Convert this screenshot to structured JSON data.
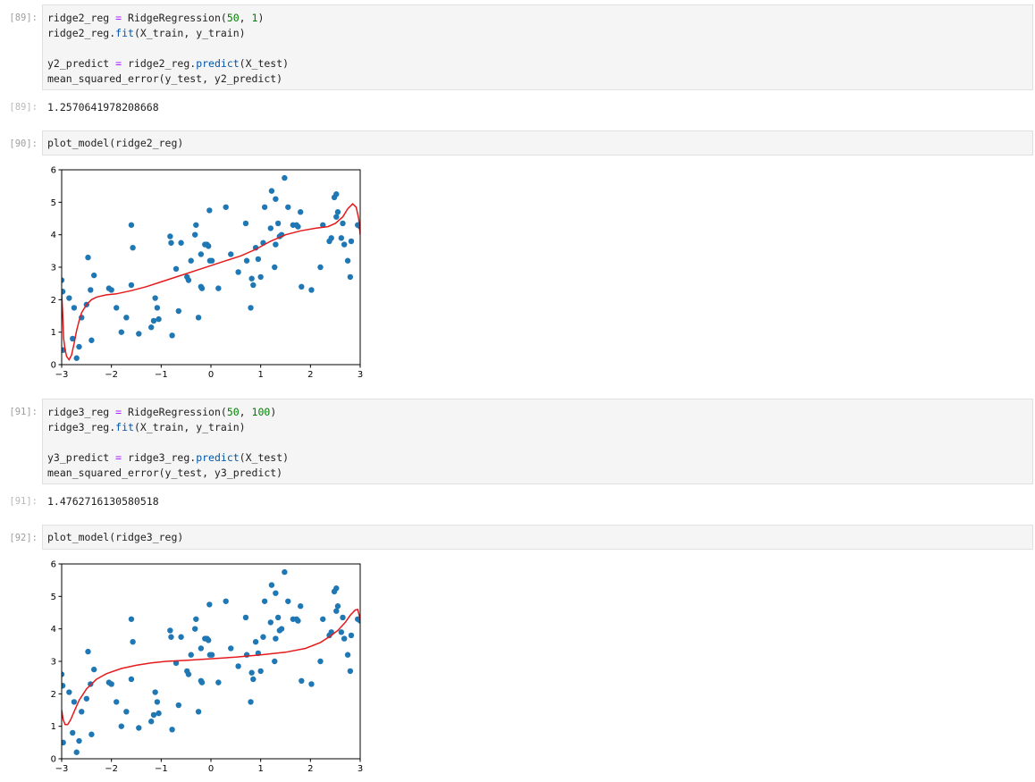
{
  "cells": [
    {
      "prompt": "[89]:",
      "lines": [
        [
          "ridge2_reg ",
          "=",
          " RidgeRegression(",
          "50",
          ", ",
          "1",
          ")"
        ],
        [
          "ridge2_reg.",
          "fit",
          "(X_train, y_train)"
        ],
        [
          ""
        ],
        [
          "y2_predict ",
          "=",
          " ridge2_reg.",
          "predict",
          "(X_test)"
        ],
        [
          "mean_squared_error(y_test, y2_predict)"
        ]
      ]
    },
    {
      "prompt": "[89]:",
      "output": "1.2570641978208668"
    },
    {
      "prompt": "[90]:",
      "code": "plot_model(ridge2_reg)"
    },
    {
      "prompt": "[91]:",
      "lines": [
        [
          "ridge3_reg ",
          "=",
          " RidgeRegression(",
          "50",
          ", ",
          "100",
          ")"
        ],
        [
          "ridge3_reg.",
          "fit",
          "(X_train, y_train)"
        ],
        [
          ""
        ],
        [
          "y3_predict ",
          "=",
          " ridge3_reg.",
          "predict",
          "(X_test)"
        ],
        [
          "mean_squared_error(y_test, y3_predict)"
        ]
      ]
    },
    {
      "prompt": "[91]:",
      "output": "1.4762716130580518"
    },
    {
      "prompt": "[92]:",
      "code": "plot_model(ridge3_reg)"
    }
  ],
  "colors": {
    "points": "#1f77b4",
    "curve": "#e41a1c"
  },
  "chart_data": [
    {
      "type": "scatter",
      "xlim": [
        -3,
        3
      ],
      "ylim": [
        0,
        6
      ],
      "xticks": [
        "−3",
        "−2",
        "−1",
        "0",
        "1",
        "2",
        "3"
      ],
      "yticks": [
        "0",
        "1",
        "2",
        "3",
        "4",
        "5",
        "6"
      ],
      "points": [
        [
          -3.0,
          2.6
        ],
        [
          -2.98,
          2.25
        ],
        [
          -2.97,
          0.45
        ],
        [
          -2.85,
          2.05
        ],
        [
          -2.78,
          0.8
        ],
        [
          -2.75,
          1.75
        ],
        [
          -2.7,
          0.2
        ],
        [
          -2.65,
          0.55
        ],
        [
          -2.6,
          1.45
        ],
        [
          -2.5,
          1.85
        ],
        [
          -2.47,
          3.3
        ],
        [
          -2.42,
          2.3
        ],
        [
          -2.4,
          0.75
        ],
        [
          -2.35,
          2.75
        ],
        [
          -2.05,
          2.35
        ],
        [
          -2.0,
          2.3
        ],
        [
          -1.9,
          1.75
        ],
        [
          -1.8,
          1.0
        ],
        [
          -1.7,
          1.45
        ],
        [
          -1.6,
          4.3
        ],
        [
          -1.57,
          3.6
        ],
        [
          -1.6,
          2.45
        ],
        [
          -1.45,
          0.95
        ],
        [
          -1.2,
          1.15
        ],
        [
          -1.15,
          1.35
        ],
        [
          -1.12,
          2.05
        ],
        [
          -1.08,
          1.75
        ],
        [
          -1.05,
          1.4
        ],
        [
          -0.82,
          3.95
        ],
        [
          -0.8,
          3.75
        ],
        [
          -0.78,
          0.9
        ],
        [
          -0.7,
          2.95
        ],
        [
          -0.65,
          1.65
        ],
        [
          -0.6,
          3.75
        ],
        [
          -0.48,
          2.7
        ],
        [
          -0.45,
          2.6
        ],
        [
          -0.4,
          3.2
        ],
        [
          -0.32,
          4.0
        ],
        [
          -0.3,
          4.3
        ],
        [
          -0.25,
          1.45
        ],
        [
          -0.2,
          2.4
        ],
        [
          -0.2,
          3.4
        ],
        [
          -0.18,
          2.35
        ],
        [
          -0.12,
          3.7
        ],
        [
          -0.08,
          3.7
        ],
        [
          -0.05,
          3.65
        ],
        [
          -0.03,
          4.75
        ],
        [
          -0.02,
          3.2
        ],
        [
          0.02,
          3.2
        ],
        [
          0.15,
          2.35
        ],
        [
          0.3,
          4.85
        ],
        [
          0.4,
          3.4
        ],
        [
          0.55,
          2.85
        ],
        [
          0.7,
          4.35
        ],
        [
          0.72,
          3.2
        ],
        [
          0.8,
          1.75
        ],
        [
          0.82,
          2.65
        ],
        [
          0.85,
          2.45
        ],
        [
          0.9,
          3.6
        ],
        [
          0.95,
          3.25
        ],
        [
          1.0,
          2.7
        ],
        [
          1.05,
          3.75
        ],
        [
          1.08,
          4.85
        ],
        [
          1.2,
          4.2
        ],
        [
          1.22,
          5.35
        ],
        [
          1.28,
          3.0
        ],
        [
          1.3,
          5.1
        ],
        [
          1.3,
          3.7
        ],
        [
          1.35,
          4.35
        ],
        [
          1.38,
          3.95
        ],
        [
          1.42,
          4.0
        ],
        [
          1.48,
          5.75
        ],
        [
          1.55,
          4.85
        ],
        [
          1.65,
          4.3
        ],
        [
          1.72,
          4.3
        ],
        [
          1.75,
          4.25
        ],
        [
          1.8,
          4.7
        ],
        [
          1.82,
          2.4
        ],
        [
          2.02,
          2.3
        ],
        [
          2.2,
          3.0
        ],
        [
          2.25,
          4.3
        ],
        [
          2.38,
          3.8
        ],
        [
          2.42,
          3.9
        ],
        [
          2.48,
          5.15
        ],
        [
          2.52,
          5.25
        ],
        [
          2.52,
          4.55
        ],
        [
          2.55,
          4.7
        ],
        [
          2.62,
          3.9
        ],
        [
          2.65,
          4.35
        ],
        [
          2.68,
          3.7
        ],
        [
          2.75,
          3.2
        ],
        [
          2.8,
          2.7
        ],
        [
          2.82,
          3.8
        ],
        [
          2.95,
          4.3
        ],
        [
          3.0,
          4.25
        ]
      ],
      "curve": [
        [
          -3.0,
          2.2
        ],
        [
          -2.98,
          1.6
        ],
        [
          -2.96,
          0.8
        ],
        [
          -2.93,
          0.45
        ],
        [
          -2.9,
          0.25
        ],
        [
          -2.85,
          0.15
        ],
        [
          -2.8,
          0.3
        ],
        [
          -2.75,
          0.65
        ],
        [
          -2.7,
          1.05
        ],
        [
          -2.65,
          1.35
        ],
        [
          -2.6,
          1.6
        ],
        [
          -2.5,
          1.85
        ],
        [
          -2.4,
          2.0
        ],
        [
          -2.3,
          2.08
        ],
        [
          -2.1,
          2.15
        ],
        [
          -1.9,
          2.18
        ],
        [
          -1.6,
          2.28
        ],
        [
          -1.3,
          2.4
        ],
        [
          -1.0,
          2.55
        ],
        [
          -0.6,
          2.75
        ],
        [
          -0.2,
          2.95
        ],
        [
          0.0,
          3.05
        ],
        [
          0.3,
          3.2
        ],
        [
          0.6,
          3.35
        ],
        [
          0.9,
          3.55
        ],
        [
          1.2,
          3.8
        ],
        [
          1.5,
          4.0
        ],
        [
          1.8,
          4.12
        ],
        [
          2.1,
          4.2
        ],
        [
          2.35,
          4.25
        ],
        [
          2.5,
          4.35
        ],
        [
          2.65,
          4.55
        ],
        [
          2.75,
          4.8
        ],
        [
          2.85,
          4.95
        ],
        [
          2.92,
          4.85
        ],
        [
          2.97,
          4.5
        ],
        [
          3.0,
          4.0
        ]
      ]
    },
    {
      "type": "scatter",
      "xlim": [
        -3,
        3
      ],
      "ylim": [
        0,
        6
      ],
      "xticks": [
        "−3",
        "−2",
        "−1",
        "0",
        "1",
        "2",
        "3"
      ],
      "yticks": [
        "0",
        "1",
        "2",
        "3",
        "4",
        "5",
        "6"
      ],
      "points": [
        [
          -3.0,
          2.6
        ],
        [
          -2.98,
          2.25
        ],
        [
          -2.97,
          0.5
        ],
        [
          -2.85,
          2.05
        ],
        [
          -2.78,
          0.8
        ],
        [
          -2.75,
          1.75
        ],
        [
          -2.7,
          0.2
        ],
        [
          -2.65,
          0.55
        ],
        [
          -2.6,
          1.45
        ],
        [
          -2.5,
          1.85
        ],
        [
          -2.47,
          3.3
        ],
        [
          -2.42,
          2.3
        ],
        [
          -2.4,
          0.75
        ],
        [
          -2.35,
          2.75
        ],
        [
          -2.05,
          2.35
        ],
        [
          -2.0,
          2.3
        ],
        [
          -1.9,
          1.75
        ],
        [
          -1.8,
          1.0
        ],
        [
          -1.7,
          1.45
        ],
        [
          -1.6,
          4.3
        ],
        [
          -1.57,
          3.6
        ],
        [
          -1.6,
          2.45
        ],
        [
          -1.45,
          0.95
        ],
        [
          -1.2,
          1.15
        ],
        [
          -1.15,
          1.35
        ],
        [
          -1.12,
          2.05
        ],
        [
          -1.08,
          1.75
        ],
        [
          -1.05,
          1.4
        ],
        [
          -0.82,
          3.95
        ],
        [
          -0.8,
          3.75
        ],
        [
          -0.78,
          0.9
        ],
        [
          -0.7,
          2.95
        ],
        [
          -0.65,
          1.65
        ],
        [
          -0.6,
          3.75
        ],
        [
          -0.48,
          2.7
        ],
        [
          -0.45,
          2.6
        ],
        [
          -0.4,
          3.2
        ],
        [
          -0.32,
          4.0
        ],
        [
          -0.3,
          4.3
        ],
        [
          -0.25,
          1.45
        ],
        [
          -0.2,
          2.4
        ],
        [
          -0.2,
          3.4
        ],
        [
          -0.18,
          2.35
        ],
        [
          -0.12,
          3.7
        ],
        [
          -0.08,
          3.7
        ],
        [
          -0.05,
          3.65
        ],
        [
          -0.03,
          4.75
        ],
        [
          -0.02,
          3.2
        ],
        [
          0.02,
          3.2
        ],
        [
          0.15,
          2.35
        ],
        [
          0.3,
          4.85
        ],
        [
          0.4,
          3.4
        ],
        [
          0.55,
          2.85
        ],
        [
          0.7,
          4.35
        ],
        [
          0.72,
          3.2
        ],
        [
          0.8,
          1.75
        ],
        [
          0.82,
          2.65
        ],
        [
          0.85,
          2.45
        ],
        [
          0.9,
          3.6
        ],
        [
          0.95,
          3.25
        ],
        [
          1.0,
          2.7
        ],
        [
          1.05,
          3.75
        ],
        [
          1.08,
          4.85
        ],
        [
          1.2,
          4.2
        ],
        [
          1.22,
          5.35
        ],
        [
          1.28,
          3.0
        ],
        [
          1.3,
          5.1
        ],
        [
          1.3,
          3.7
        ],
        [
          1.35,
          4.35
        ],
        [
          1.38,
          3.95
        ],
        [
          1.42,
          4.0
        ],
        [
          1.48,
          5.75
        ],
        [
          1.55,
          4.85
        ],
        [
          1.65,
          4.3
        ],
        [
          1.72,
          4.3
        ],
        [
          1.75,
          4.25
        ],
        [
          1.8,
          4.7
        ],
        [
          1.82,
          2.4
        ],
        [
          2.02,
          2.3
        ],
        [
          2.2,
          3.0
        ],
        [
          2.25,
          4.3
        ],
        [
          2.38,
          3.8
        ],
        [
          2.42,
          3.9
        ],
        [
          2.48,
          5.15
        ],
        [
          2.52,
          5.25
        ],
        [
          2.52,
          4.55
        ],
        [
          2.55,
          4.7
        ],
        [
          2.62,
          3.9
        ],
        [
          2.65,
          4.35
        ],
        [
          2.68,
          3.7
        ],
        [
          2.75,
          3.2
        ],
        [
          2.8,
          2.7
        ],
        [
          2.82,
          3.8
        ],
        [
          2.95,
          4.3
        ],
        [
          3.0,
          4.25
        ]
      ],
      "curve": [
        [
          -3.0,
          1.5
        ],
        [
          -2.97,
          1.2
        ],
        [
          -2.93,
          1.05
        ],
        [
          -2.88,
          1.05
        ],
        [
          -2.82,
          1.2
        ],
        [
          -2.75,
          1.45
        ],
        [
          -2.65,
          1.8
        ],
        [
          -2.5,
          2.15
        ],
        [
          -2.3,
          2.45
        ],
        [
          -2.1,
          2.62
        ],
        [
          -1.8,
          2.78
        ],
        [
          -1.5,
          2.88
        ],
        [
          -1.2,
          2.95
        ],
        [
          -0.9,
          3.0
        ],
        [
          -0.5,
          3.03
        ],
        [
          0.0,
          3.08
        ],
        [
          0.5,
          3.13
        ],
        [
          1.0,
          3.2
        ],
        [
          1.5,
          3.28
        ],
        [
          1.9,
          3.4
        ],
        [
          2.2,
          3.58
        ],
        [
          2.4,
          3.78
        ],
        [
          2.55,
          3.95
        ],
        [
          2.7,
          4.2
        ],
        [
          2.8,
          4.42
        ],
        [
          2.9,
          4.58
        ],
        [
          2.95,
          4.6
        ],
        [
          3.0,
          4.3
        ]
      ]
    }
  ]
}
